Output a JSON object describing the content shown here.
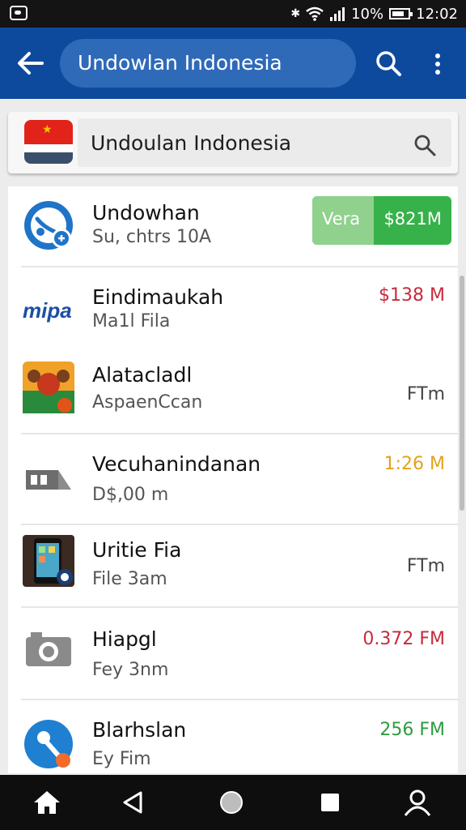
{
  "status_bar": {
    "battery": "10%",
    "time": "12:02"
  },
  "app_bar": {
    "title": "Undowlan Indonesia"
  },
  "search": {
    "query": "Undoulan Indonesia"
  },
  "list": [
    {
      "title": "Undowhan",
      "subtitle": "Su, chtrs 10A",
      "button_left": "Vera",
      "button_right": "$821M",
      "icon": "satellite-app-icon"
    },
    {
      "title": "Eindimaukah",
      "subtitle": "Ma1l Fila",
      "value": "$138 M",
      "value_color": "#c62b3c",
      "icon": "mipa-logo-icon"
    },
    {
      "title": "Alatacladl",
      "subtitle": "AspaenCcan",
      "value": "FTm",
      "value_color": "#444444",
      "icon": "game-app-icon"
    },
    {
      "title": "Vecuhanindanan",
      "subtitle": "D$,00 m",
      "value": "1:26 M",
      "value_color": "#e3a21a",
      "icon": "camera-app-icon"
    },
    {
      "title": "Uritie Fia",
      "subtitle": "File 3am",
      "value": "FTm",
      "value_color": "#444444",
      "icon": "phone-app-icon"
    },
    {
      "title": "Hiapgl",
      "subtitle": "Fey 3nm",
      "value": "0.372 FM",
      "value_color": "#c62b3c",
      "icon": "photo-camera-icon"
    },
    {
      "title": "Blarhslan",
      "subtitle": "Ey Fim",
      "value": "256 FM",
      "value_color": "#2e9c3f",
      "icon": "key-app-icon"
    }
  ],
  "colors": {
    "app_bar": "#0d4a9e",
    "search_pill": "#2f6ab8",
    "download_green": "#37b24a",
    "download_light": "#8fd18d"
  },
  "nav": [
    "home-icon",
    "back-icon",
    "home-circle-icon",
    "recents-icon",
    "profile-icon"
  ]
}
